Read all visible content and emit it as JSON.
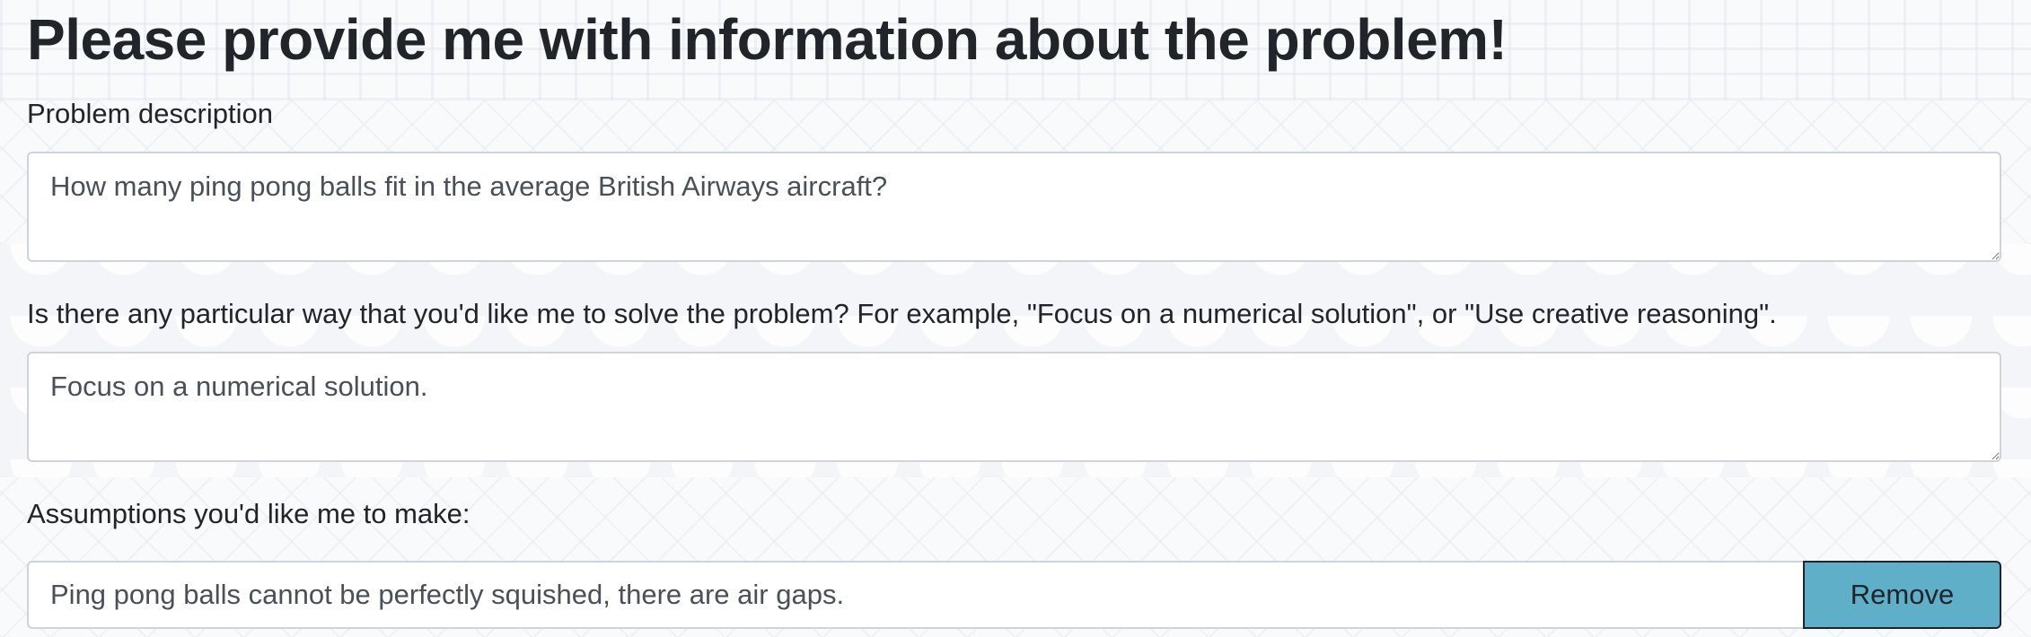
{
  "page": {
    "title": "Please provide me with information about the problem!"
  },
  "problem": {
    "label": "Problem description",
    "value": "How many ping pong balls fit in the average British Airways aircraft?"
  },
  "approach": {
    "label": "Is there any particular way that you'd like me to solve the problem? For example, \"Focus on a numerical solution\", or \"Use creative reasoning\".",
    "value": "Focus on a numerical solution."
  },
  "assumptions": {
    "label": "Assumptions you'd like me to make:",
    "items": [
      {
        "value": "Ping pong balls cannot be perfectly squished, there are air gaps.",
        "remove_label": "Remove"
      }
    ]
  },
  "colors": {
    "remove_button": "#5fafc8",
    "text": "#212529",
    "input_border": "#ced4da"
  }
}
